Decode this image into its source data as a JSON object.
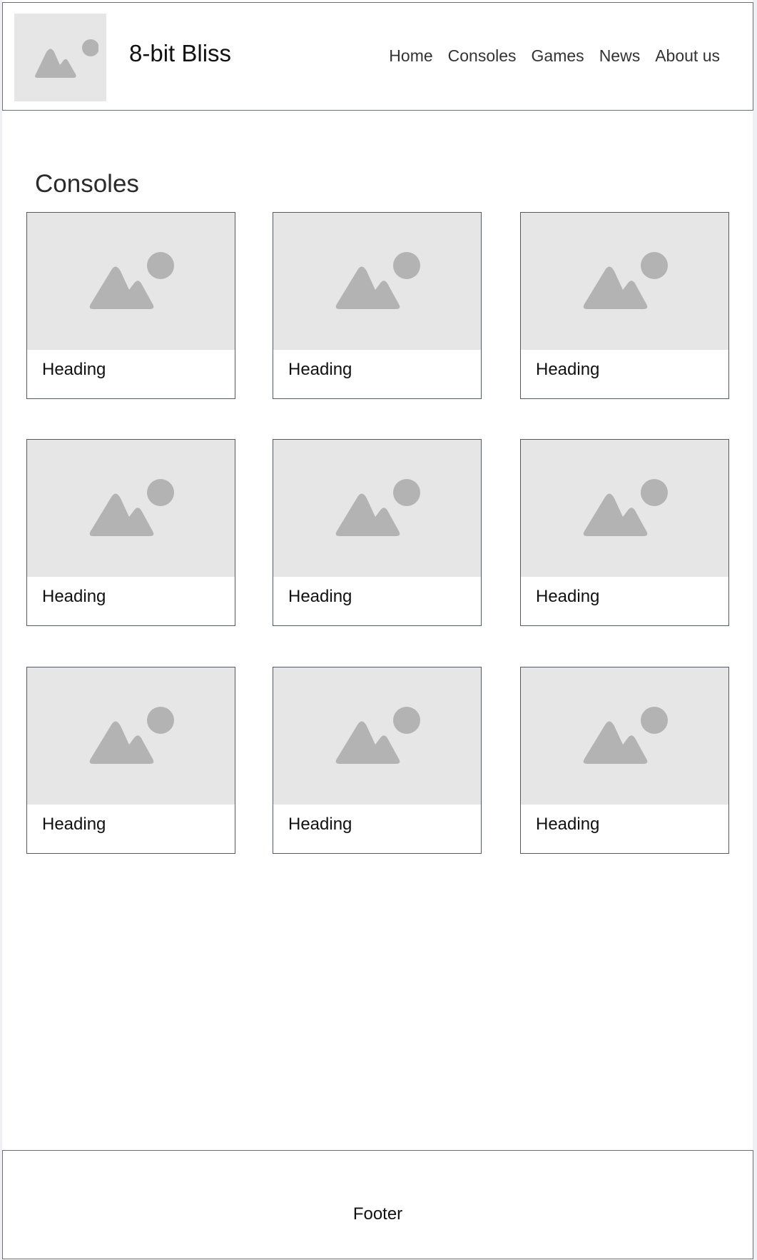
{
  "header": {
    "site_title": "8-bit Bliss",
    "logo_icon": "image-placeholder-icon",
    "nav": [
      "Home",
      "Consoles",
      "Games",
      "News",
      "About us"
    ]
  },
  "main": {
    "section_title": "Consoles",
    "cards": [
      {
        "heading": "Heading",
        "image_icon": "image-placeholder-icon"
      },
      {
        "heading": "Heading",
        "image_icon": "image-placeholder-icon"
      },
      {
        "heading": "Heading",
        "image_icon": "image-placeholder-icon"
      },
      {
        "heading": "Heading",
        "image_icon": "image-placeholder-icon"
      },
      {
        "heading": "Heading",
        "image_icon": "image-placeholder-icon"
      },
      {
        "heading": "Heading",
        "image_icon": "image-placeholder-icon"
      },
      {
        "heading": "Heading",
        "image_icon": "image-placeholder-icon"
      },
      {
        "heading": "Heading",
        "image_icon": "image-placeholder-icon"
      },
      {
        "heading": "Heading",
        "image_icon": "image-placeholder-icon"
      }
    ]
  },
  "footer": {
    "label": "Footer"
  },
  "colors": {
    "placeholder_bg": "#e6e6e6",
    "placeholder_icon": "#b3b3b3",
    "border": "#555a60",
    "page_bg": "#ffffff",
    "outer_bg": "#eef0f4"
  }
}
